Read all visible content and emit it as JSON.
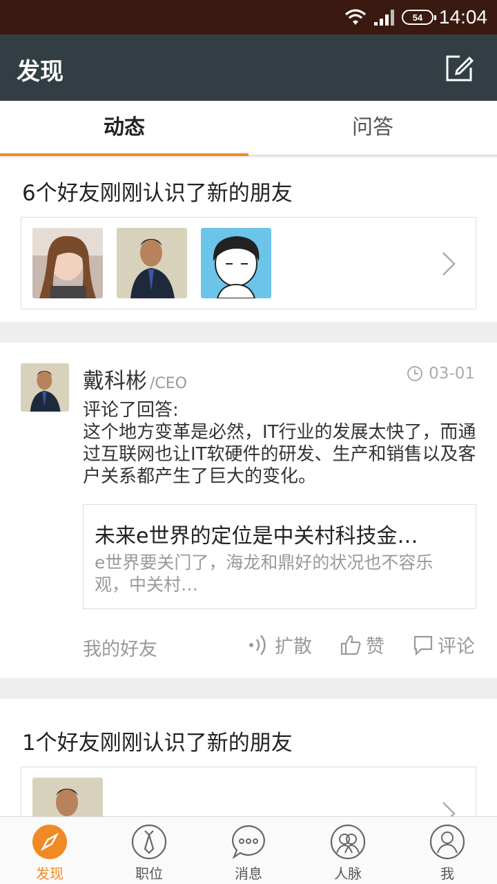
{
  "status_bar": {
    "time": "14:04",
    "battery": "54",
    "icons": [
      "wifi-icon",
      "signal-icon",
      "battery-icon"
    ]
  },
  "app_bar": {
    "title": "发现",
    "action_icon": "compose-icon"
  },
  "tabs": [
    {
      "label": "动态",
      "active": true
    },
    {
      "label": "问答",
      "active": false
    }
  ],
  "friend_card_1": {
    "title": "6个好友刚刚认识了新的朋友"
  },
  "post": {
    "author": "戴科彬",
    "role": "/CEO",
    "time": "03-01",
    "text": "评论了回答:\n这个地方变革是必然，IT行业的发展太快了，而通过互联网也让IT软硬件的研发、生产和销售以及客户关系都产生了巨大的变化。",
    "quote_title": "未来e世界的定位是中关村科技金…",
    "quote_text": "e世界要关门了，海龙和鼎好的状况也不容乐观，中关村…",
    "source": "我的好友",
    "actions": {
      "spread": "扩散",
      "like": "赞",
      "comment": "评论"
    }
  },
  "friend_card_2": {
    "title": "1个好友刚刚认识了新的朋友"
  },
  "bottom_nav": [
    {
      "label": "发现",
      "icon": "compass-icon",
      "active": true
    },
    {
      "label": "职位",
      "icon": "tie-icon",
      "active": false
    },
    {
      "label": "消息",
      "icon": "chat-icon",
      "active": false
    },
    {
      "label": "人脉",
      "icon": "contacts-icon",
      "active": false
    },
    {
      "label": "我",
      "icon": "profile-icon",
      "active": false
    }
  ],
  "colors": {
    "accent": "#f08a24",
    "app_bar": "#333e44",
    "status_bar": "#3a1a10"
  }
}
